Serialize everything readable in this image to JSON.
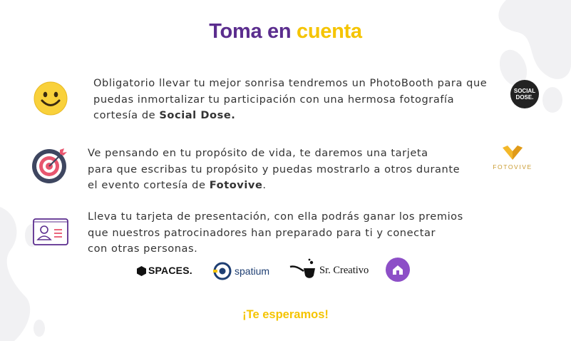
{
  "title": {
    "part1": "Toma en",
    "part2": "cuenta"
  },
  "items": [
    {
      "icon": "smiley-icon",
      "lines": [
        "Obligatorio llevar tu mejor sonrisa tendremos un PhotoBooth para que",
        "puedas inmortalizar tu participación con una hermosa fotografía"
      ],
      "last_prefix": "cortesía de ",
      "last_bold": "Social Dose.",
      "last_suffix": "",
      "logo_icon": "social-dose-logo",
      "logo_lines": [
        "SOCIAL",
        "DOSE."
      ]
    },
    {
      "icon": "target-icon",
      "lines": [
        "Ve pensando en tu propósito de vida, te daremos una tarjeta",
        "para que escribas tu propósito y puedas mostrarlo a otros durante"
      ],
      "last_prefix": "el evento cortesía de ",
      "last_bold": "Fotovive",
      "last_suffix": ".",
      "logo_icon": "fotovive-logo",
      "logo_text": "FOTOVIVE"
    },
    {
      "icon": "id-card-icon",
      "lines": [
        "Lleva tu tarjeta de presentación, con ella podrás ganar los premios",
        "que nuestros patrocinadores han preparado para ti y conectar",
        "con otras personas."
      ]
    }
  ],
  "sponsors": [
    {
      "icon": "hexagon-icon",
      "name": "SPACES."
    },
    {
      "icon": "spatium-circle-icon",
      "name": "spatium"
    },
    {
      "icon": "pipe-icon",
      "name": "Sr. Creativo"
    },
    {
      "icon": "purple-badge-icon",
      "name": ""
    }
  ],
  "footer": "¡Te esperamos!",
  "colors": {
    "purple": "#5b2d8e",
    "yellow": "#f5c400",
    "text": "#333333",
    "blob": "#f1f1f3"
  }
}
